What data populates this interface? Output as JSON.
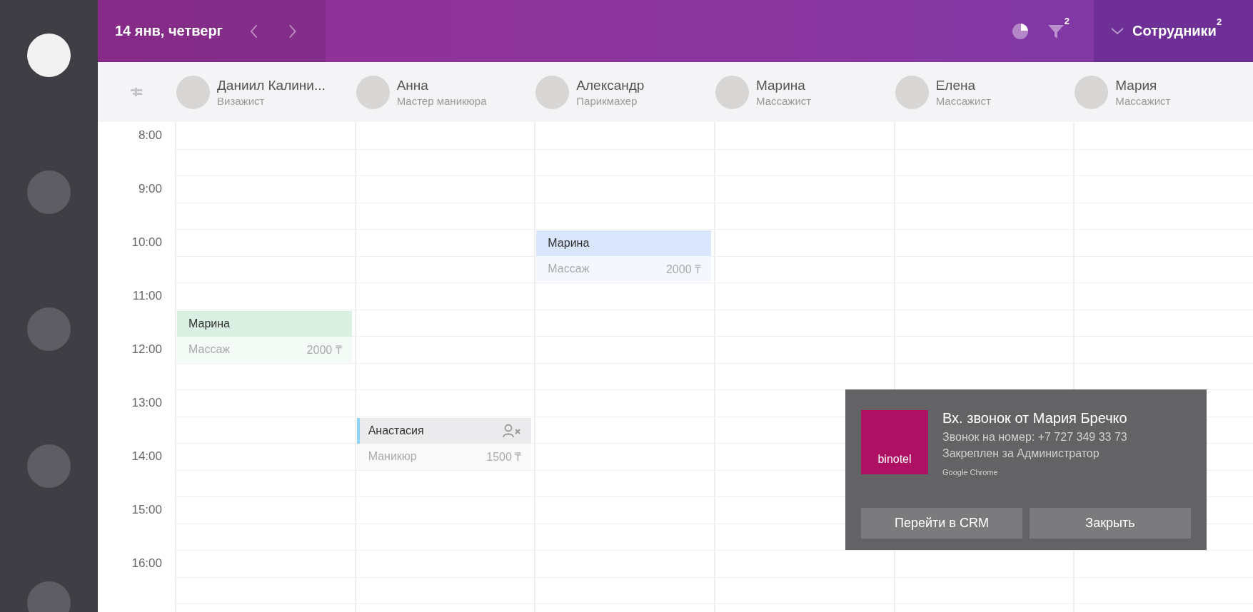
{
  "sidebar": {
    "items": [
      {
        "selected": true
      },
      {
        "selected": false
      },
      {
        "selected": false
      },
      {
        "selected": false
      },
      {
        "selected": false
      }
    ]
  },
  "header": {
    "date": "14 янв, четверг",
    "filter_badge": "2",
    "staff_button": {
      "label": "Сотрудники",
      "badge": "2"
    }
  },
  "times": [
    "8:00",
    "9:00",
    "10:00",
    "11:00",
    "12:00",
    "13:00",
    "14:00",
    "15:00",
    "16:00"
  ],
  "staff": [
    {
      "name": "Даниил Калини...",
      "role": "Визажист",
      "slots": [
        {
          "kind": "free"
        },
        {
          "kind": "free"
        },
        {
          "kind": "free"
        },
        {
          "kind": "free"
        },
        {
          "kind": "free"
        },
        {
          "kind": "free"
        },
        {
          "kind": "free"
        },
        {
          "kind": "appointment",
          "client": "Марина",
          "service": "Массаж",
          "price": "2000 ₸",
          "color": "#d9f0e2",
          "flagged": false
        },
        {
          "kind": "free"
        },
        {
          "kind": "free"
        },
        {
          "kind": "free"
        },
        {
          "kind": "free"
        },
        {
          "kind": "free"
        },
        {
          "kind": "free"
        },
        {
          "kind": "free"
        },
        {
          "kind": "free"
        },
        {
          "kind": "free"
        },
        {
          "kind": "free"
        }
      ]
    },
    {
      "name": "Анна",
      "role": "Мастер маникюра",
      "slots": [
        {
          "kind": "free"
        },
        {
          "kind": "free"
        },
        {
          "kind": "free"
        },
        {
          "kind": "free"
        },
        {
          "kind": "free"
        },
        {
          "kind": "free"
        },
        {
          "kind": "free"
        },
        {
          "kind": "free"
        },
        {
          "kind": "free"
        },
        {
          "kind": "free"
        },
        {
          "kind": "free"
        },
        {
          "kind": "appointment",
          "client": "Анастасия",
          "service": "Маникюр",
          "price": "1500 ₸",
          "color": "#ebebed",
          "flagged": true
        },
        {
          "kind": "free"
        },
        {
          "kind": "free"
        },
        {
          "kind": "free"
        },
        {
          "kind": "free"
        },
        {
          "kind": "free"
        },
        {
          "kind": "free"
        }
      ]
    },
    {
      "name": "Александр",
      "role": "Парикмахер",
      "slots": [
        {
          "kind": "free"
        },
        {
          "kind": "free"
        },
        {
          "kind": "free"
        },
        {
          "kind": "free"
        },
        {
          "kind": "appointment",
          "client": "Марина",
          "service": "Массаж",
          "price": "2000 ₸",
          "color": "#dae6fb",
          "flagged": false
        },
        {
          "kind": "free"
        },
        {
          "kind": "free"
        },
        {
          "kind": "free"
        },
        {
          "kind": "free"
        },
        {
          "kind": "free"
        },
        {
          "kind": "free"
        },
        {
          "kind": "free"
        },
        {
          "kind": "free"
        },
        {
          "kind": "free"
        },
        {
          "kind": "free"
        },
        {
          "kind": "free"
        },
        {
          "kind": "free"
        },
        {
          "kind": "free"
        }
      ]
    },
    {
      "name": "Марина",
      "role": "Массажист",
      "slots": [
        {
          "kind": "free"
        },
        {
          "kind": "free"
        },
        {
          "kind": "free"
        },
        {
          "kind": "free"
        },
        {
          "kind": "free"
        },
        {
          "kind": "free"
        },
        {
          "kind": "free"
        },
        {
          "kind": "free"
        },
        {
          "kind": "free"
        },
        {
          "kind": "free"
        },
        {
          "kind": "free"
        },
        {
          "kind": "free"
        },
        {
          "kind": "free"
        },
        {
          "kind": "free"
        },
        {
          "kind": "free"
        },
        {
          "kind": "free"
        },
        {
          "kind": "free"
        },
        {
          "kind": "free"
        },
        {
          "kind": "free"
        }
      ]
    },
    {
      "name": "Елена",
      "role": "Массажист",
      "slots": [
        {
          "kind": "free"
        },
        {
          "kind": "free"
        },
        {
          "kind": "free"
        },
        {
          "kind": "free"
        },
        {
          "kind": "free"
        },
        {
          "kind": "free"
        },
        {
          "kind": "free"
        },
        {
          "kind": "free"
        },
        {
          "kind": "free"
        },
        {
          "kind": "free"
        },
        {
          "kind": "free"
        },
        {
          "kind": "free"
        },
        {
          "kind": "free"
        },
        {
          "kind": "free"
        },
        {
          "kind": "free"
        },
        {
          "kind": "free"
        },
        {
          "kind": "free"
        },
        {
          "kind": "free"
        },
        {
          "kind": "free"
        }
      ]
    },
    {
      "name": "Мария",
      "role": "Массажист",
      "slots": [
        {
          "kind": "free"
        },
        {
          "kind": "free"
        },
        {
          "kind": "free"
        },
        {
          "kind": "free"
        },
        {
          "kind": "free"
        },
        {
          "kind": "free"
        },
        {
          "kind": "free"
        },
        {
          "kind": "free"
        },
        {
          "kind": "free"
        },
        {
          "kind": "free"
        },
        {
          "kind": "free"
        },
        {
          "kind": "free"
        },
        {
          "kind": "free"
        },
        {
          "kind": "free"
        },
        {
          "kind": "free"
        },
        {
          "kind": "free"
        },
        {
          "kind": "free"
        },
        {
          "kind": "free"
        },
        {
          "kind": "free"
        }
      ]
    }
  ],
  "notification": {
    "logo": "binotel",
    "title": "Вх. звонок от Мария Бречко",
    "lines": [
      "Звонок на номер: +7 727 349 33 73",
      "Закреплен за Администратор"
    ],
    "source": "Google Chrome",
    "buttons": [
      "Перейти в CRM",
      "Закрыть"
    ]
  }
}
